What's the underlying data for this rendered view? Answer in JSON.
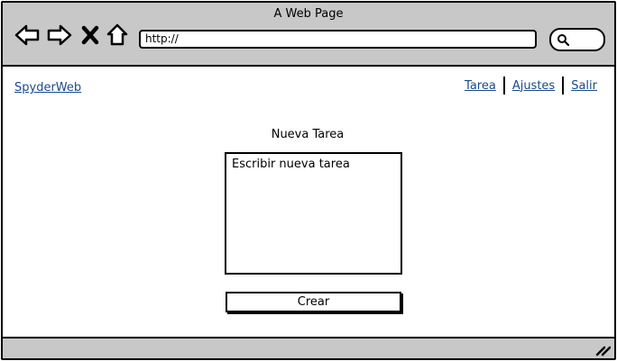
{
  "window": {
    "title": "A Web Page"
  },
  "toolbar": {
    "address_value": "http://",
    "icons": [
      "back-arrow-icon",
      "forward-arrow-icon",
      "close-x-icon",
      "home-icon",
      "search-icon"
    ]
  },
  "header": {
    "brand": "SpyderWeb",
    "nav": [
      {
        "label": "Tarea"
      },
      {
        "label": "Ajustes"
      },
      {
        "label": "Salir"
      }
    ]
  },
  "main": {
    "title": "Nueva Tarea",
    "task_placeholder": "Escribir nueva tarea",
    "create_label": "Crear"
  },
  "colors": {
    "chrome": "#c8c8c8",
    "link": "#1a4a8a"
  }
}
